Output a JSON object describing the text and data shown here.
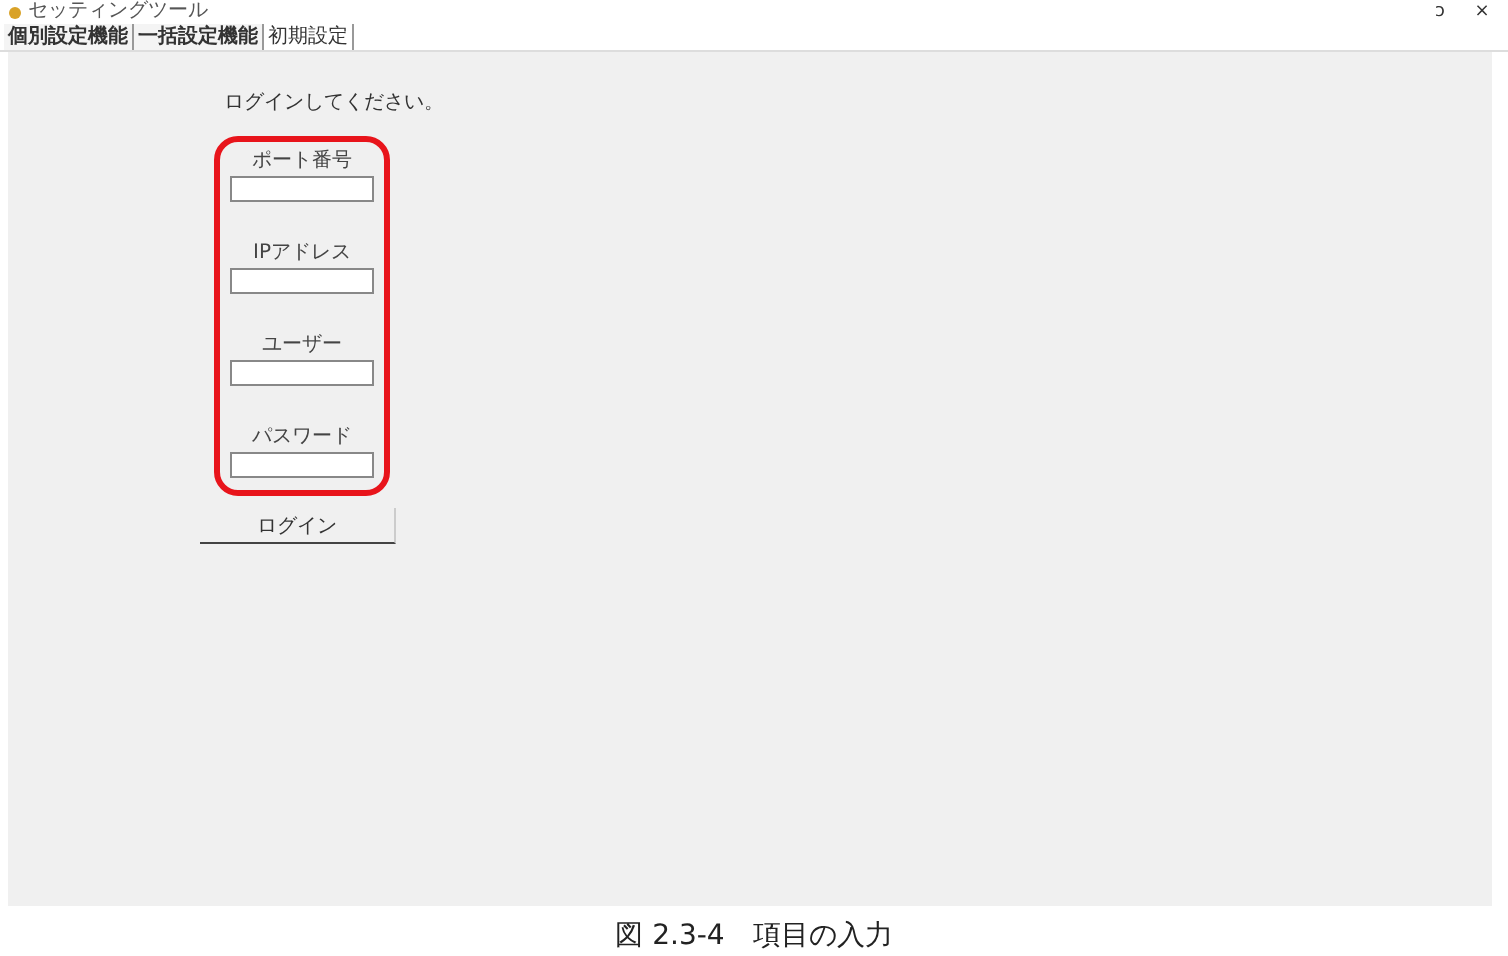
{
  "window": {
    "title": "セッティングツール",
    "controls": [
      "ɔ",
      "×"
    ]
  },
  "tabs": [
    {
      "label": "個別設定機能",
      "selected": false
    },
    {
      "label": "一括設定機能",
      "selected": false
    },
    {
      "label": "初期設定",
      "selected": true
    }
  ],
  "login": {
    "prompt": "ログインしてください。",
    "highlighted": true,
    "fields": [
      {
        "label": "ポート番号"
      },
      {
        "label": "IPアドレス"
      },
      {
        "label": "ユーザー"
      },
      {
        "label": "パスワード"
      }
    ],
    "button": "ログイン"
  },
  "caption": "図 2.3-4　項目の入力"
}
